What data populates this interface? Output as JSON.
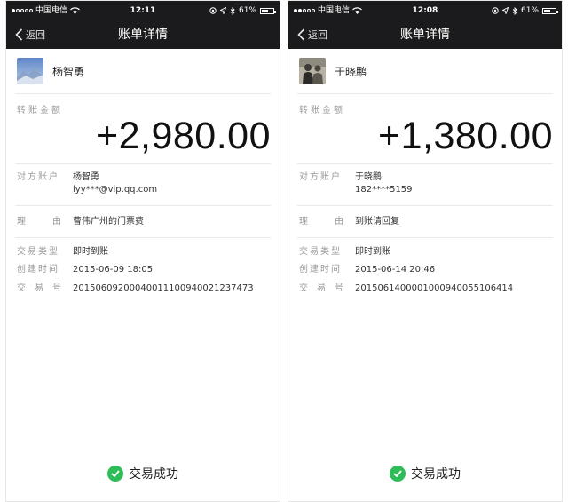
{
  "screens": [
    {
      "status": {
        "carrier": "中国电信",
        "time": "12:11",
        "battery": "61%",
        "battery_level": 0.61
      },
      "nav": {
        "back_label": "返回",
        "title": "账单详情"
      },
      "user": {
        "name": "杨智勇"
      },
      "amount_label": "转账金额",
      "amount": "+2,980.00",
      "details": {
        "account_label": "对方账户",
        "account_name": "杨智勇",
        "account_id": "lyy***@vip.qq.com",
        "reason_label_1": "理",
        "reason_label_2": "由",
        "reason": "曹伟广州的门票费",
        "type_label": "交易类型",
        "type": "即时到账",
        "created_label": "创建时间",
        "created": "2015-06-09 18:05",
        "txn_label_1": "交",
        "txn_label_2": "易",
        "txn_label_3": "号",
        "txn": "2015060920004001110094002123747​3"
      },
      "success_text": "交易成功"
    },
    {
      "status": {
        "carrier": "中国电信",
        "time": "12:08",
        "battery": "61%",
        "battery_level": 0.61
      },
      "nav": {
        "back_label": "返回",
        "title": "账单详情"
      },
      "user": {
        "name": "于晓鹏"
      },
      "amount_label": "转账金额",
      "amount": "+1,380.00",
      "details": {
        "account_label": "对方账户",
        "account_name": "于晓鹏",
        "account_id": "182****5159",
        "reason_label_1": "理",
        "reason_label_2": "由",
        "reason": "到账请回复",
        "type_label": "交易类型",
        "type": "即时到账",
        "created_label": "创建时间",
        "created": "2015-06-14 20:46",
        "txn_label_1": "交",
        "txn_label_2": "易",
        "txn_label_3": "号",
        "txn": "2015061400001000940055106414"
      },
      "success_text": "交易成功"
    }
  ],
  "colors": {
    "bar": "#1b1b1d",
    "success": "#2fbd5a",
    "label": "#9a9a9a"
  },
  "icons": [
    "signal-dots-icon",
    "wifi-icon",
    "location-icon",
    "bluetooth-icon",
    "battery-icon",
    "back-chevron-icon",
    "avatar-photo",
    "check-circle-icon"
  ]
}
